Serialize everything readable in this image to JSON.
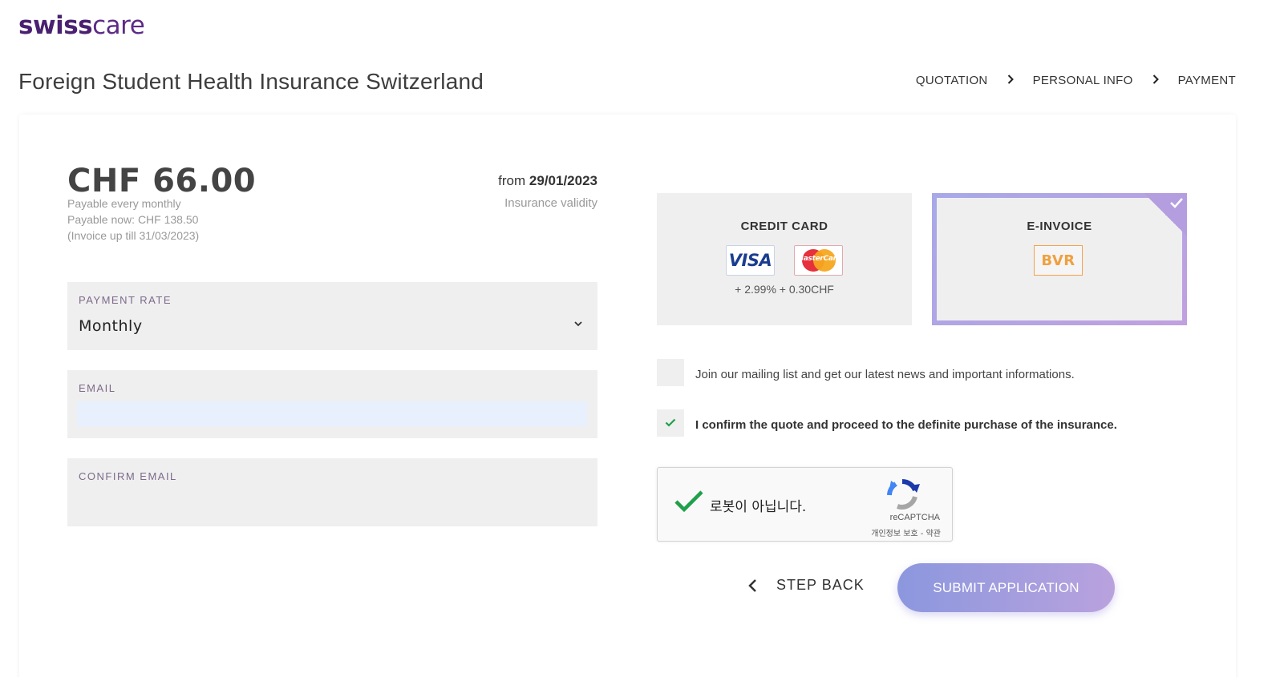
{
  "brand": {
    "part1": "swiss",
    "part2": "care"
  },
  "page": {
    "title": "Foreign Student Health Insurance Switzerland"
  },
  "steps": [
    {
      "label": "QUOTATION"
    },
    {
      "label": "PERSONAL INFO"
    },
    {
      "label": "PAYMENT"
    }
  ],
  "summary": {
    "price": "CHF 66.00",
    "payable_every": "Payable every monthly",
    "payable_now": "Payable now: CHF 138.50",
    "invoice_until": "(Invoice up till 31/03/2023)",
    "from_prefix": "from",
    "from_date": "29/01/2023",
    "validity_label": "Insurance validity"
  },
  "form": {
    "payment_rate_label": "PAYMENT RATE",
    "payment_rate_value": "Monthly",
    "email_label": "EMAIL",
    "email_value": "",
    "confirm_email_label": "CONFIRM EMAIL",
    "confirm_email_value": ""
  },
  "payment_methods": {
    "credit_card": {
      "title": "CREDIT CARD",
      "visa": "VISA",
      "mastercard": "MasterCard",
      "fee": "+ 2.99% + 0.30CHF",
      "selected": false
    },
    "einvoice": {
      "title": "E-INVOICE",
      "bvr": "BVR",
      "selected": true
    }
  },
  "checkboxes": {
    "mailing": {
      "label": "Join our mailing list and get our latest news and important informations.",
      "checked": false
    },
    "confirm": {
      "label": "I confirm the quote and proceed to the definite purchase of the insurance.",
      "checked": true
    }
  },
  "captcha": {
    "text": "로봇이 아닙니다.",
    "brand": "reCAPTCHA",
    "links": "개인정보 보호 - 약관"
  },
  "actions": {
    "back_label": "STEP BACK",
    "submit_label": "SUBMIT APPLICATION"
  },
  "colors": {
    "brand_purple": "#4a2170",
    "accent_gradient_start": "#8c97de",
    "accent_gradient_end": "#b9a2de",
    "check_green": "#1fa04a"
  }
}
